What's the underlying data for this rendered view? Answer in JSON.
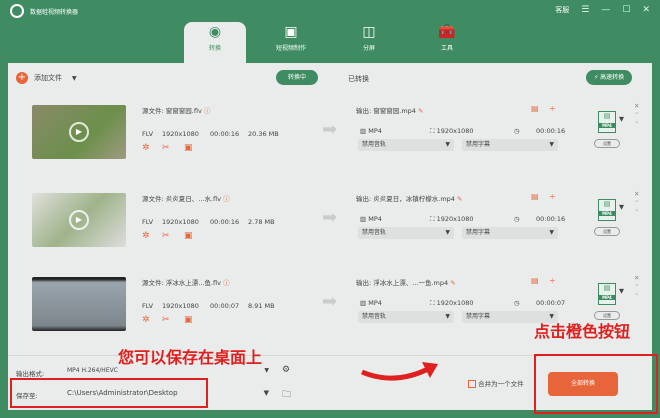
{
  "app": {
    "title": "数据蛙视频转换器",
    "support": "客服"
  },
  "tabs": [
    {
      "label": "转换",
      "icon": "convert-icon"
    },
    {
      "label": "短视频制作",
      "icon": "tv-icon"
    },
    {
      "label": "分屏",
      "icon": "split-screen-icon"
    },
    {
      "label": "工具",
      "icon": "toolbox-icon"
    }
  ],
  "toolbar": {
    "add_file": "添加文件",
    "converting": "转换中",
    "converted": "已转换",
    "fast_convert": "高速转换"
  },
  "labels": {
    "source": "源文件:",
    "output": "输出:",
    "audio": "禁用音轨",
    "subtitle": "禁用字幕",
    "settings": "设置",
    "fmt_badge": "MP4"
  },
  "files": [
    {
      "src": "窗窗窗园.flv",
      "format": "FLV",
      "res": "1920x1080",
      "dur": "00:00:16",
      "size": "20.36 MB",
      "out": "窗窗窗园.mp4",
      "out_format": "MP4",
      "out_res": "1920x1080",
      "out_dur": "00:00:16"
    },
    {
      "src": "炎炎夏日、...水.flv",
      "format": "FLV",
      "res": "1920x1080",
      "dur": "00:00:16",
      "size": "2.78 MB",
      "out": "炎炎夏日，冰镇柠檬水.mp4",
      "out_format": "MP4",
      "out_res": "1920x1080",
      "out_dur": "00:00:16"
    },
    {
      "src": "浮冰水上漂...鱼.flv",
      "format": "FLV",
      "res": "1920x1080",
      "dur": "00:00:07",
      "size": "8.91 MB",
      "out": "浮冰水上漂、...一鱼.mp4",
      "out_format": "MP4",
      "out_res": "1920x1080",
      "out_dur": "00:00:07"
    }
  ],
  "bottom": {
    "format_label": "输出格式:",
    "format_value": "MP4 H.264/HEVC",
    "save_label": "保存至:",
    "save_path": "C:\\Users\\Administrator\\Desktop",
    "merge": "合并为一个文件",
    "convert_all": "全部转换"
  },
  "annotations": {
    "left": "您可以保存在桌面上",
    "right": "点击橙色按钮"
  },
  "colors": {
    "brand": "#3f8c62",
    "accent": "#e8643a",
    "annotation": "#e02020"
  }
}
